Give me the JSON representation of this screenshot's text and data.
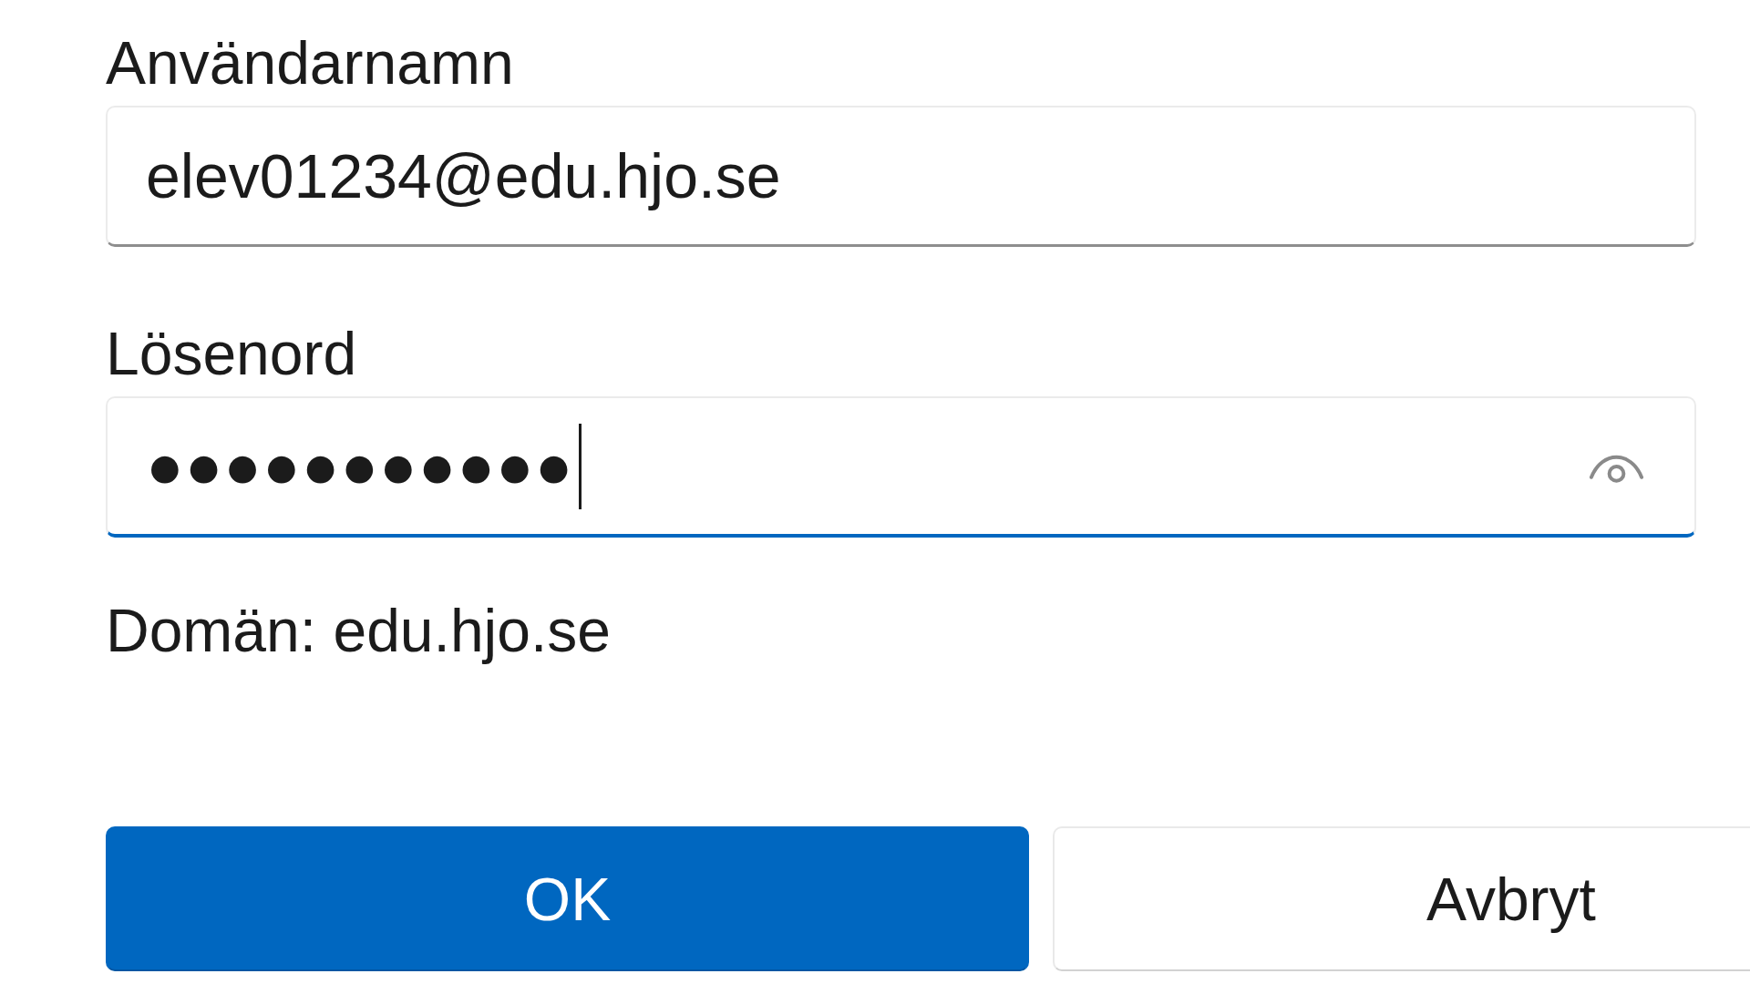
{
  "fields": [
    {
      "kind": "text",
      "label": "Användarnamn",
      "value": "elev01234@edu.hjo.se",
      "focused": false
    },
    {
      "kind": "password",
      "label": "Lösenord",
      "value": "●●●●●●●●●●●",
      "focused": true
    }
  ],
  "domain_note": "Domän: edu.hjo.se",
  "buttons": [
    {
      "kind": "primary",
      "label": "OK"
    },
    {
      "kind": "secondary",
      "label": "Avbryt"
    }
  ]
}
